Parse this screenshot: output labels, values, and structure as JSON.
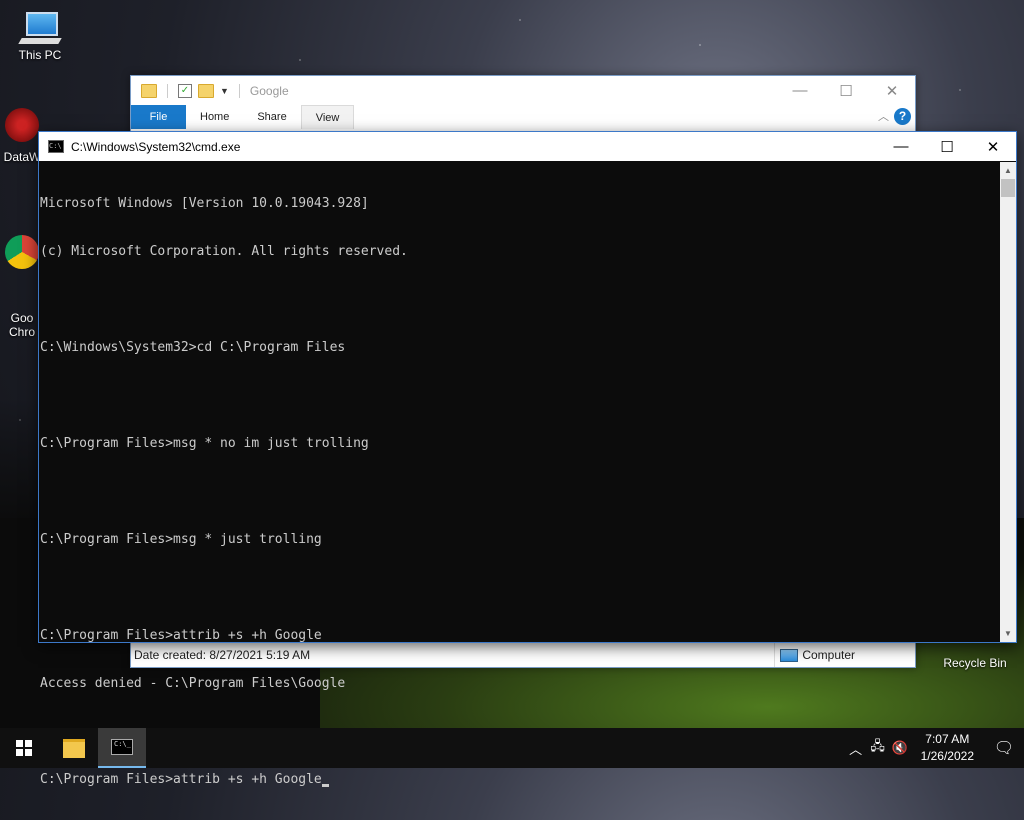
{
  "desktop": {
    "icons": [
      {
        "label": "This PC"
      },
      {
        "label": "DataW"
      },
      {
        "label": "Goo\nChro"
      },
      {
        "label": "Recycle Bin"
      }
    ]
  },
  "explorer": {
    "title": "Google",
    "tabs": [
      "File",
      "Home",
      "Share",
      "View"
    ],
    "status_left": "Date created: 8/27/2021 5:19 AM",
    "status_right": "Computer",
    "help": "?"
  },
  "cmd": {
    "title": "C:\\Windows\\System32\\cmd.exe",
    "lines": [
      "Microsoft Windows [Version 10.0.19043.928]",
      "(c) Microsoft Corporation. All rights reserved.",
      "",
      "C:\\Windows\\System32>cd C:\\Program Files",
      "",
      "C:\\Program Files>msg * no im just trolling",
      "",
      "C:\\Program Files>msg * just trolling",
      "",
      "C:\\Program Files>attrib +s +h Google",
      "Access denied - C:\\Program Files\\Google",
      "",
      "C:\\Program Files>attrib +s +h Google"
    ]
  },
  "taskbar": {
    "time": "7:07 AM",
    "date": "1/26/2022"
  },
  "colors": {
    "accent": "#1979ca",
    "console_bg": "#0c0c0c",
    "console_fg": "#cccccc"
  }
}
